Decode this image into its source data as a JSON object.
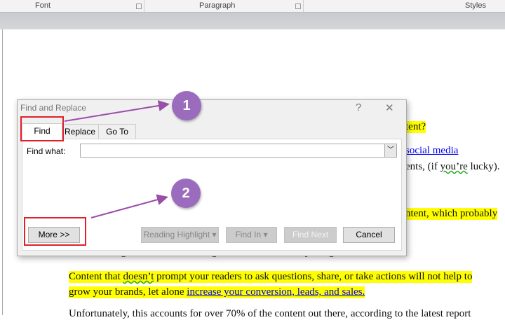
{
  "ribbon": {
    "groups": [
      "Font",
      "Paragraph",
      "Styles"
    ]
  },
  "document": {
    "line1": "tent?",
    "line2_link": "social media",
    "line3_a": "ents, (if ",
    "line3_sq": "you’re",
    "line3_b": " lucky).",
    "line4": "ntent, which probably",
    "line5": "There is a big difference between good content and compelling content.",
    "para_a": "Content that ",
    "para_sq": "doesn’t",
    "para_b": " prompt your readers to ask questions, share, or take actions will not help to",
    "para2_a": "grow your brands, let alone ",
    "para2_link": "increase your conversion, leads, and sales.",
    "line_last": "Unfortunately, this accounts for over 70% of the content out there, according to the latest report"
  },
  "dialog": {
    "title": "Find and Replace",
    "help": "?",
    "close": "✕",
    "tabs": [
      "Find",
      "Replace",
      "Go To"
    ],
    "find_label": "Find what:",
    "find_value": "",
    "buttons": {
      "more": "More >>",
      "reading_highlight": "Reading Highlight ▾",
      "find_in": "Find In ▾",
      "find_next": "Find Next",
      "cancel": "Cancel"
    }
  },
  "annotations": {
    "step1": "1",
    "step2": "2",
    "color": "#9b6bbd",
    "box_color": "#e0202a"
  }
}
